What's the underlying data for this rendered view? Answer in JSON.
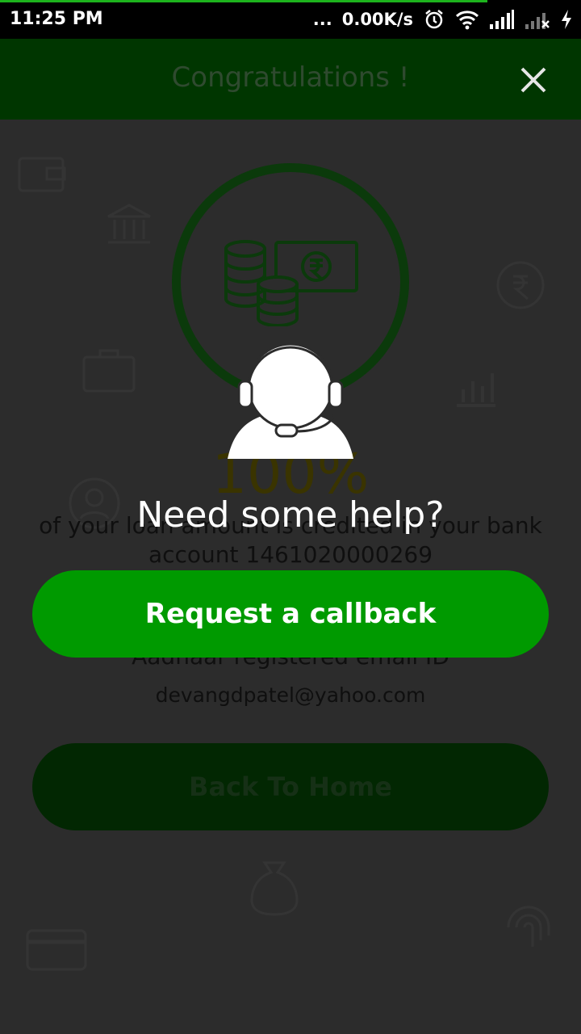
{
  "status_bar": {
    "time": "11:25 PM",
    "dots": "...",
    "speed": "0.00K/s",
    "icons": [
      "alarm-icon",
      "wifi-icon",
      "signal-icon",
      "signal-off-icon",
      "charging-icon"
    ]
  },
  "app_bar": {
    "title": "Congratulations !",
    "close_icon": "close-icon"
  },
  "success": {
    "percent": "100%",
    "message_line1": "of your loan amount is credited in your bank",
    "message_line2": "account 1461020000269",
    "email_label": "Aadhaar registered email ID",
    "email": "devangdpatel@yahoo.com",
    "back_button": "Back To Home"
  },
  "help_overlay": {
    "title": "Need some help?",
    "callback_button": "Request a callback",
    "icon": "customer-support-icon"
  },
  "colors": {
    "accent": "#009a00",
    "status_progress": "#1db31d",
    "app_bar": "#003600"
  }
}
